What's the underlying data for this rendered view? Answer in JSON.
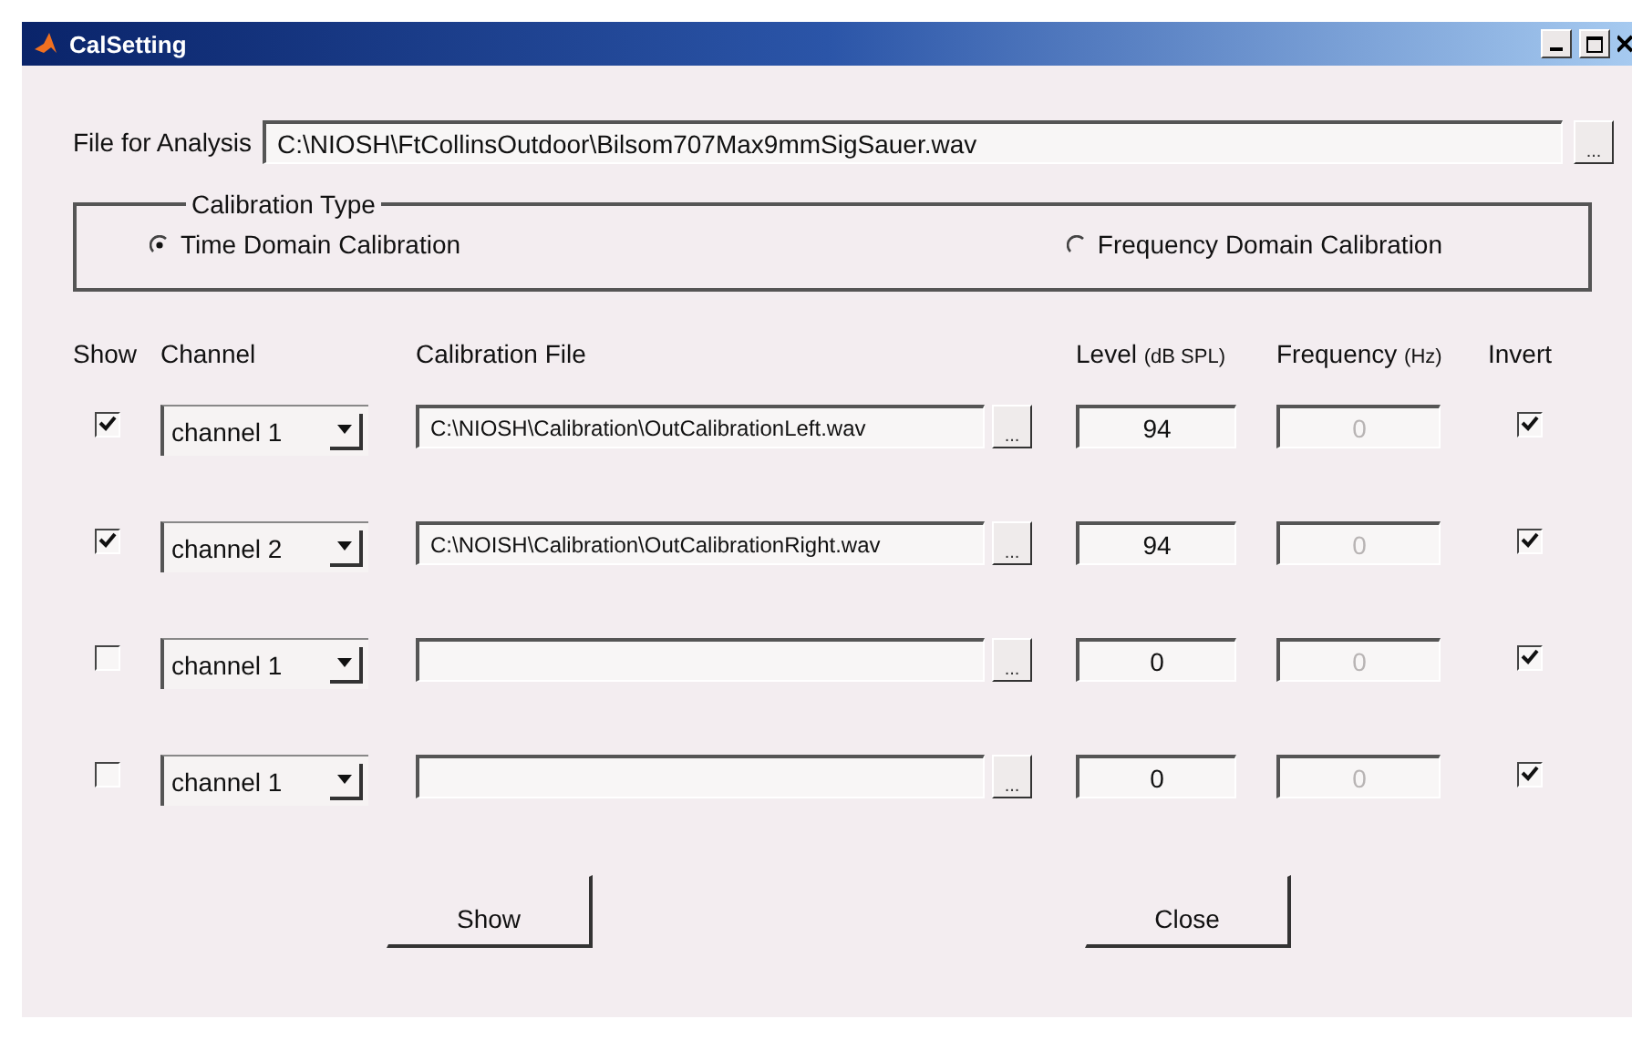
{
  "window": {
    "title": "CalSetting"
  },
  "analysis_file": {
    "label": "File for Analysis",
    "value": "C:\\NIOSH\\FtCollinsOutdoor\\Bilsom707Max9mmSigSauer.wav",
    "browse": "..."
  },
  "calibration_type": {
    "title": "Calibration Type",
    "options": [
      {
        "label": "Time Domain Calibration",
        "selected": true
      },
      {
        "label": "Frequency Domain Calibration",
        "selected": false
      }
    ]
  },
  "table": {
    "columns": [
      {
        "label": "Show"
      },
      {
        "label": "Channel"
      },
      {
        "label": "Calibration File"
      },
      {
        "label": "Level",
        "unit": "(dB SPL)"
      },
      {
        "label": "Frequency",
        "unit": "(Hz)"
      },
      {
        "label": "Invert"
      }
    ],
    "rows": [
      {
        "show": true,
        "channel": "channel 1",
        "file": "C:\\NIOSH\\Calibration\\OutCalibrationLeft.wav",
        "browse": "...",
        "level": "94",
        "frequency": "0",
        "frequency_disabled": true,
        "invert": true
      },
      {
        "show": true,
        "channel": "channel 2",
        "file": "C:\\NOISH\\Calibration\\OutCalibrationRight.wav",
        "browse": "...",
        "level": "94",
        "frequency": "0",
        "frequency_disabled": true,
        "invert": true
      },
      {
        "show": false,
        "channel": "channel 1",
        "browse": "...",
        "level": "0",
        "frequency": "0",
        "frequency_disabled": true,
        "invert": true
      },
      {
        "show": false,
        "channel": "channel 1",
        "browse": "...",
        "level": "0",
        "frequency": "0",
        "frequency_disabled": true,
        "invert": true
      }
    ]
  },
  "buttons": [
    "Show",
    "Close"
  ]
}
